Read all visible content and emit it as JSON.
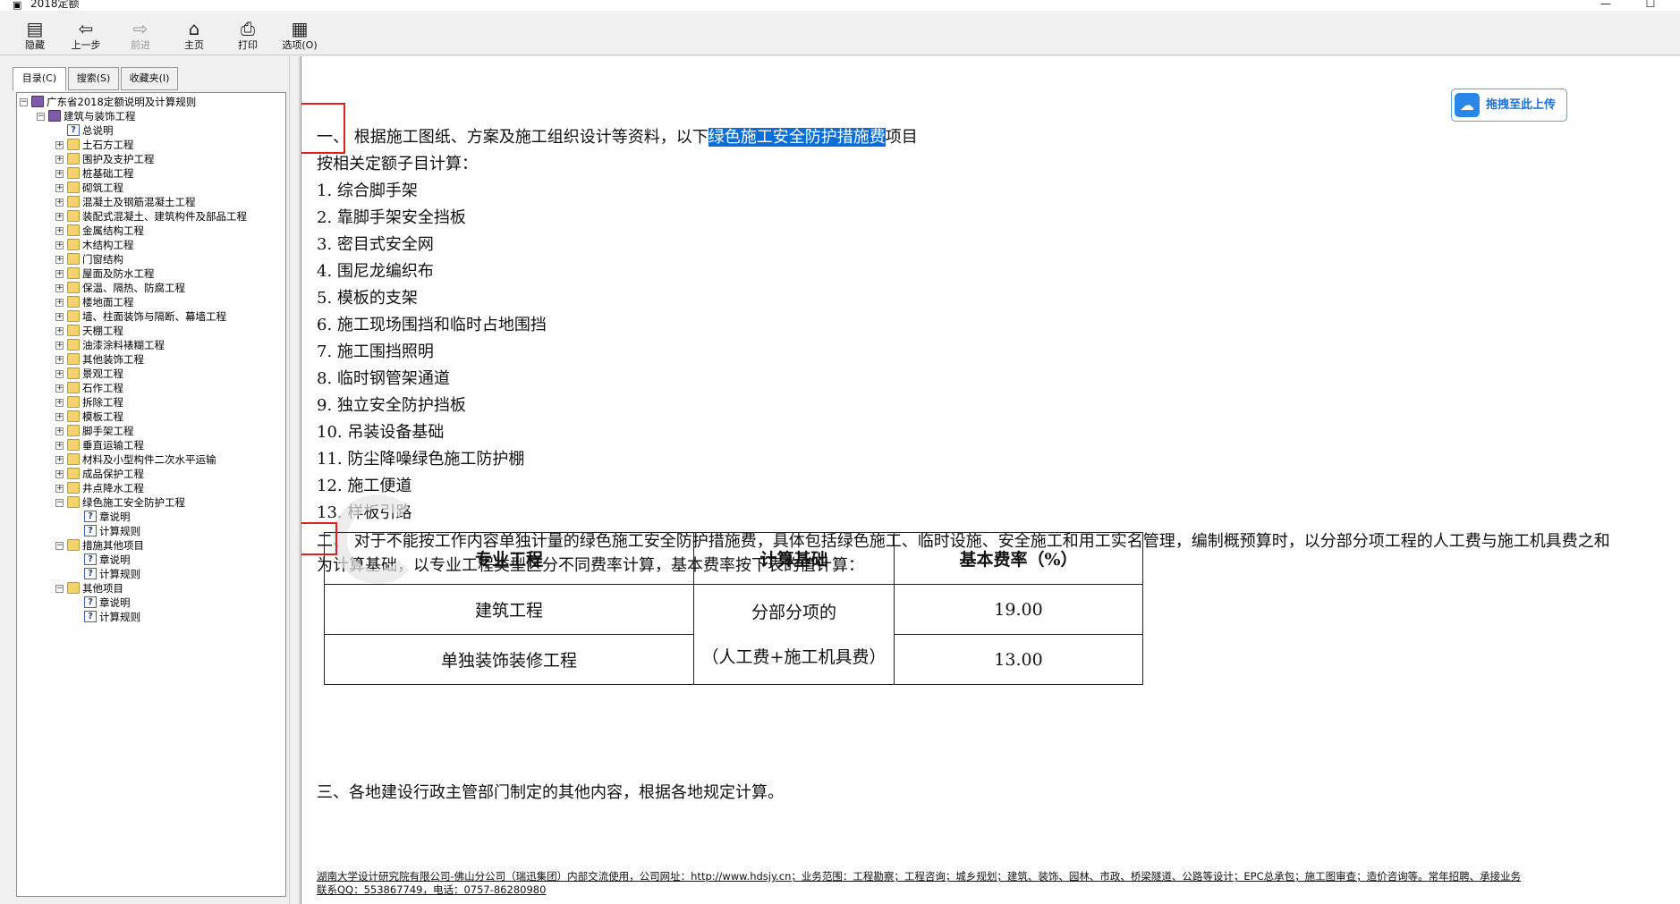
{
  "window": {
    "title": "2018定额",
    "minimize": "—",
    "maximize": "☐"
  },
  "toolbar": [
    {
      "id": "hide",
      "label": "隐藏",
      "icon": "hide-icon",
      "glyph": "▤",
      "enabled": true
    },
    {
      "id": "back",
      "label": "上一步",
      "icon": "back-arrow-icon",
      "glyph": "⇦",
      "enabled": true
    },
    {
      "id": "forward",
      "label": "前进",
      "icon": "forward-arrow-icon",
      "glyph": "⇨",
      "enabled": false
    },
    {
      "id": "home",
      "label": "主页",
      "icon": "home-icon",
      "glyph": "⌂",
      "enabled": true
    },
    {
      "id": "print",
      "label": "打印",
      "icon": "printer-icon",
      "glyph": "⎙",
      "enabled": true
    },
    {
      "id": "options",
      "label": "选项(O)",
      "icon": "options-icon",
      "glyph": "▦",
      "enabled": true
    }
  ],
  "tabs": [
    {
      "label": "目录(C)",
      "active": true
    },
    {
      "label": "搜索(S)",
      "active": false
    },
    {
      "label": "收藏夹(I)",
      "active": false
    }
  ],
  "tree": [
    {
      "label": "广东省2018定额说明及计算规则",
      "level": 0,
      "icon": "book",
      "expander": "−"
    },
    {
      "label": "建筑与装饰工程",
      "level": 1,
      "icon": "book",
      "expander": "−"
    },
    {
      "label": "总说明",
      "level": 2,
      "icon": "help",
      "expander": ""
    },
    {
      "label": "土石方工程",
      "level": 2,
      "icon": "folder",
      "expander": "+"
    },
    {
      "label": "围护及支护工程",
      "level": 2,
      "icon": "folder",
      "expander": "+"
    },
    {
      "label": "桩基础工程",
      "level": 2,
      "icon": "folder",
      "expander": "+"
    },
    {
      "label": "砌筑工程",
      "level": 2,
      "icon": "folder",
      "expander": "+"
    },
    {
      "label": "混凝土及钢筋混凝土工程",
      "level": 2,
      "icon": "folder",
      "expander": "+"
    },
    {
      "label": "装配式混凝土、建筑构件及部品工程",
      "level": 2,
      "icon": "folder",
      "expander": "+"
    },
    {
      "label": "金属结构工程",
      "level": 2,
      "icon": "folder",
      "expander": "+"
    },
    {
      "label": "木结构工程",
      "level": 2,
      "icon": "folder",
      "expander": "+"
    },
    {
      "label": "门窗结构",
      "level": 2,
      "icon": "folder",
      "expander": "+"
    },
    {
      "label": "屋面及防水工程",
      "level": 2,
      "icon": "folder",
      "expander": "+"
    },
    {
      "label": "保温、隔热、防腐工程",
      "level": 2,
      "icon": "folder",
      "expander": "+"
    },
    {
      "label": "楼地面工程",
      "level": 2,
      "icon": "folder",
      "expander": "+"
    },
    {
      "label": "墙、柱面装饰与隔断、幕墙工程",
      "level": 2,
      "icon": "folder",
      "expander": "+"
    },
    {
      "label": "天棚工程",
      "level": 2,
      "icon": "folder",
      "expander": "+"
    },
    {
      "label": "油漆涂料裱糊工程",
      "level": 2,
      "icon": "folder",
      "expander": "+"
    },
    {
      "label": "其他装饰工程",
      "level": 2,
      "icon": "folder",
      "expander": "+"
    },
    {
      "label": "景观工程",
      "level": 2,
      "icon": "folder",
      "expander": "+"
    },
    {
      "label": "石作工程",
      "level": 2,
      "icon": "folder",
      "expander": "+"
    },
    {
      "label": "拆除工程",
      "level": 2,
      "icon": "folder",
      "expander": "+"
    },
    {
      "label": "模板工程",
      "level": 2,
      "icon": "folder",
      "expander": "+"
    },
    {
      "label": "脚手架工程",
      "level": 2,
      "icon": "folder",
      "expander": "+"
    },
    {
      "label": "垂直运输工程",
      "level": 2,
      "icon": "folder",
      "expander": "+"
    },
    {
      "label": "材料及小型构件二次水平运输",
      "level": 2,
      "icon": "folder",
      "expander": "+"
    },
    {
      "label": "成品保护工程",
      "level": 2,
      "icon": "folder",
      "expander": "+"
    },
    {
      "label": "井点降水工程",
      "level": 2,
      "icon": "folder",
      "expander": "+"
    },
    {
      "label": "绿色施工安全防护工程",
      "level": 2,
      "icon": "folder",
      "expander": "−"
    },
    {
      "label": "章说明",
      "level": 3,
      "icon": "help",
      "expander": ""
    },
    {
      "label": "计算规则",
      "level": 3,
      "icon": "help",
      "expander": ""
    },
    {
      "label": "措施其他项目",
      "level": 2,
      "icon": "folder",
      "expander": "−"
    },
    {
      "label": "章说明",
      "level": 3,
      "icon": "help",
      "expander": ""
    },
    {
      "label": "计算规则",
      "level": 3,
      "icon": "help",
      "expander": ""
    },
    {
      "label": "其他项目",
      "level": 2,
      "icon": "folder",
      "expander": "−"
    },
    {
      "label": "章说明",
      "level": 3,
      "icon": "help",
      "expander": ""
    },
    {
      "label": "计算规则",
      "level": 3,
      "icon": "help",
      "expander": ""
    }
  ],
  "content": {
    "upload_label": "拖拽至此上传",
    "p1_prefix": "一、 根据施工图纸、方案及施工组织设计等资料，以下",
    "p1_highlight": "绿色施工安全防护措施费",
    "p1_suffix": "项目",
    "p1_line2": "按相关定额子目计算：",
    "items": [
      "1.  综合脚手架",
      "2.  靠脚手架安全挡板",
      "3.  密目式安全网",
      "4.  围尼龙编织布",
      "5.  模板的支架",
      "6.  施工现场围挡和临时占地围挡",
      "7.  施工围挡照明",
      "8.  临时钢管架通道",
      "9.  独立安全防护挡板",
      "10.  吊装设备基础",
      "11.  防尘降噪绿色施工防护棚",
      "12.  施工便道",
      "13.  样板引路"
    ],
    "p2_line1": "二、 对于不能按工作内容单独计量的绿色施工安全防护措施费，具体包括绿色施工、临时设施、安全施工和用工实名管理，编制概预算时，以分部分项工程的人工费与施工机具费之和",
    "p2_line2": "为计算基础，以专业工程类型区分不同费率计算，基本费率按下表的值计算：",
    "table": {
      "headers": [
        "专业工程",
        "计算基础",
        "基本费率（%）"
      ],
      "rows": [
        {
          "project": "建筑工程",
          "rate": "19.00"
        },
        {
          "project": "单独装饰装修工程",
          "rate": "13.00"
        }
      ],
      "basis_line1": "分部分项的",
      "basis_line2": "（人工费+施工机具费）"
    },
    "p3": "三、各地建设行政主管部门制定的其他内容，根据各地规定计算。",
    "footer_line1": "湖南大学设计研究院有限公司-佛山分公司（瑞迅集团）内部交流使用，公司网址：http://www.hdsjy.cn；业务范围：工程勘察；工程咨询；城乡规划；建筑、装饰、园林、市政、桥梁隧道、公路等设计；EPC总承包；施工图审查；造价咨询等。常年招聘、承接业务",
    "footer_line2": "联系QQ：553867749，电话：0757-86280980"
  }
}
